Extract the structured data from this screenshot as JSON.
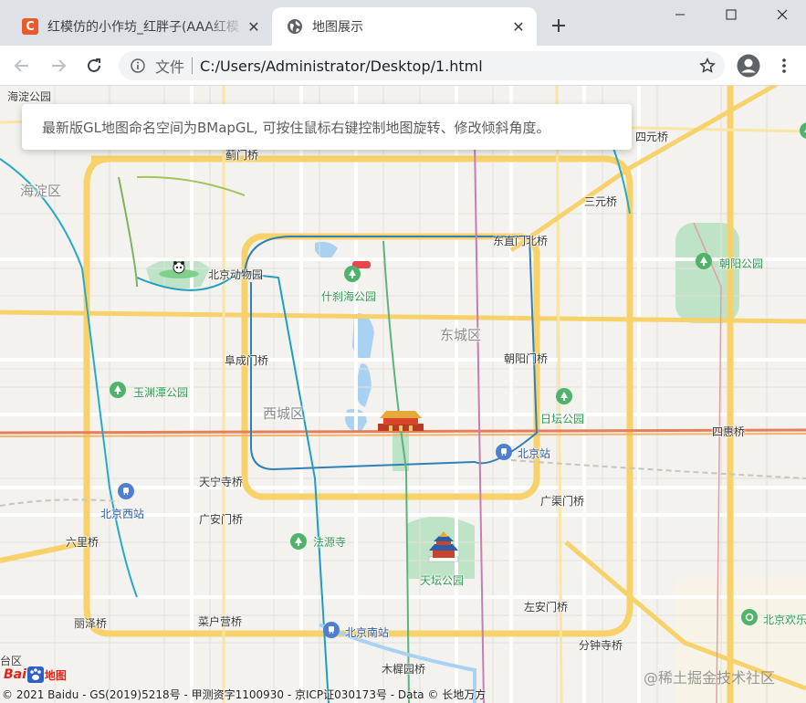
{
  "browser": {
    "tabs": [
      {
        "title": "红模仿的小作坊_红胖子(AAA红模",
        "favicon": "C",
        "active": false
      },
      {
        "title": "地图展示",
        "favicon": "globe-icon",
        "active": true
      }
    ],
    "address": {
      "scheme_label": "文件",
      "url": "C:/Users/Administrator/Desktop/1.html"
    }
  },
  "map": {
    "info": "最新版GL地图命名空间为BMapGL, 可按住鼠标右键控制地图旋转、修改倾斜角度。",
    "labels": {
      "haidian_park": "海淀公园",
      "haidian_district": "海淀区",
      "jimenqiao": "蓟门桥",
      "siyuanqiao": "四元桥",
      "sanyuanqiao": "三元桥",
      "dongzhimenbeiqiao": "东直门北桥",
      "chaoyang_park": "朝阳公园",
      "beijing_zoo": "北京动物园",
      "shichahai_park": "什刹海公园",
      "dongcheng_district": "东城区",
      "fuchengmenqiao": "阜成门桥",
      "chaoyangmenqiao": "朝阳门桥",
      "yuyuantan_park": "玉渊潭公园",
      "xicheng_district": "西城区",
      "ritan_park": "日坛公园",
      "sihuiqiao": "四惠桥",
      "beijing_station": "北京站",
      "tianningsiqiao": "天宁寺桥",
      "beijing_west_station": "北京西站",
      "guangqumenqiao": "广渠门桥",
      "guanganmenqiao": "广安门桥",
      "liuliqiao": "六里桥",
      "fayuansi": "法源寺",
      "tiantan_park": "天坛公园",
      "lizeqiao": "丽泽桥",
      "caihuyingqiao": "菜户营桥",
      "zuoanmenqiao": "左安门桥",
      "beijing_south_station": "北京南站",
      "beijing_happy_valley": "北京欢乐",
      "fenzhongsiqiao": "分钟寺桥",
      "muxiyuanqiao": "木樨园桥",
      "taiqu": "台区"
    },
    "copyright": "© 2021 Baidu - GS(2019)5218号 - 甲测资字1100930 - 京ICP证030173号 - Data © 长地万方",
    "logo_text": "Bai",
    "logo_suffix": "地图",
    "watermark": "@稀土掘金技术社区"
  }
}
